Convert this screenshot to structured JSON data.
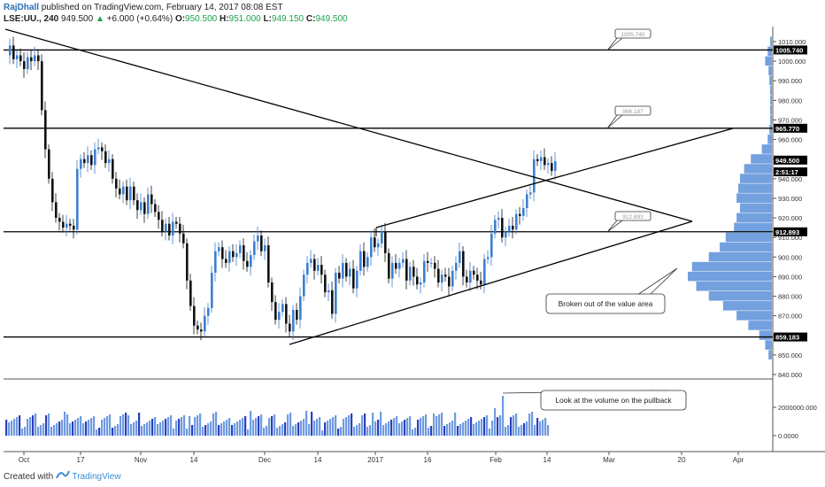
{
  "header": {
    "author": "RajDhall",
    "published": "published on TradingView.com, February 14, 2017 08:08 EST",
    "symbol": "LSE:UU., 240",
    "last": "949.500",
    "change_arrow": "▲",
    "change": "+6.000 (+0.64%)",
    "o_label": "O:",
    "o_value": "950.500",
    "h_label": "H:",
    "h_value": "951.000",
    "l_label": "L:",
    "l_value": "949.150",
    "c_label": "C:",
    "c_value": "949.500"
  },
  "footer": {
    "created_with": "Created with",
    "brand": "TradingView"
  },
  "colors": {
    "up_candle": "#3d7fd0",
    "down_candle": "#111111",
    "volume": "#6f9be0",
    "volume_profile": "#5b8fd8",
    "tag": "#000000"
  },
  "chart_data": {
    "type": "candlestick",
    "price_axis": {
      "min": 840,
      "max": 1015,
      "ticks": [
        "1010.000",
        "1000.000",
        "990.000",
        "980.000",
        "970.000",
        "960.000",
        "950.000",
        "940.000",
        "930.000",
        "920.000",
        "910.000",
        "900.000",
        "890.000",
        "880.000",
        "870.000",
        "860.000",
        "850.000",
        "840.000"
      ]
    },
    "volume_axis": {
      "ticks": [
        "2000000.000",
        "0.0000"
      ]
    },
    "x_ticks": [
      "Oct",
      "17",
      "Nov",
      "14",
      "Dec",
      "14",
      "2017",
      "16",
      "Feb",
      "14",
      "Mar",
      "20",
      "Apr"
    ],
    "price_tags": [
      {
        "label": "1005.740",
        "value": 1005.74,
        "style": "solid"
      },
      {
        "label": "965.770",
        "value": 965.77,
        "style": "solid"
      },
      {
        "label": "949.500",
        "value": 949.5,
        "style": "solid"
      },
      {
        "label": "2:51:17",
        "value": 943.5,
        "style": "solid"
      },
      {
        "label": "912.893",
        "value": 912.893,
        "style": "solid"
      },
      {
        "label": "859.183",
        "value": 859.183,
        "style": "solid"
      }
    ],
    "horizontal_levels": [
      1005.74,
      965.77,
      912.893,
      859.183
    ],
    "level_callouts": [
      "1005.740",
      "966.187",
      "912.893"
    ],
    "annotations": [
      "Broken out of the value area",
      "Look at the volume on the pullback"
    ],
    "price_path": [
      [
        0,
        1003
      ],
      [
        4,
        1008
      ],
      [
        8,
        1001
      ],
      [
        12,
        1003
      ],
      [
        16,
        1000
      ],
      [
        20,
        996
      ],
      [
        24,
        1002
      ],
      [
        28,
        1000
      ],
      [
        32,
        1003
      ],
      [
        36,
        1000
      ],
      [
        40,
        975
      ],
      [
        44,
        955
      ],
      [
        48,
        940
      ],
      [
        52,
        928
      ],
      [
        56,
        920
      ],
      [
        60,
        918
      ],
      [
        64,
        915
      ],
      [
        68,
        917
      ],
      [
        72,
        916
      ],
      [
        76,
        914
      ],
      [
        80,
        945
      ],
      [
        84,
        950
      ],
      [
        88,
        948
      ],
      [
        92,
        952
      ],
      [
        96,
        947
      ],
      [
        100,
        955
      ],
      [
        104,
        956
      ],
      [
        108,
        954
      ],
      [
        112,
        948
      ],
      [
        116,
        950
      ],
      [
        120,
        940
      ],
      [
        124,
        935
      ],
      [
        128,
        932
      ],
      [
        132,
        936
      ],
      [
        136,
        929
      ],
      [
        140,
        936
      ],
      [
        144,
        929
      ],
      [
        148,
        924
      ],
      [
        152,
        928
      ],
      [
        156,
        922
      ],
      [
        160,
        932
      ],
      [
        164,
        927
      ],
      [
        168,
        923
      ],
      [
        172,
        919
      ],
      [
        176,
        913
      ],
      [
        180,
        917
      ],
      [
        184,
        911
      ],
      [
        188,
        918
      ],
      [
        192,
        917
      ],
      [
        196,
        912
      ],
      [
        200,
        907
      ],
      [
        204,
        888
      ],
      [
        208,
        875
      ],
      [
        212,
        865
      ],
      [
        216,
        863
      ],
      [
        220,
        862
      ],
      [
        224,
        870
      ],
      [
        228,
        874
      ],
      [
        232,
        892
      ],
      [
        236,
        903
      ],
      [
        240,
        905
      ],
      [
        244,
        899
      ],
      [
        248,
        897
      ],
      [
        252,
        903
      ],
      [
        256,
        900
      ],
      [
        260,
        902
      ],
      [
        264,
        906
      ],
      [
        268,
        898
      ],
      [
        272,
        895
      ],
      [
        276,
        901
      ],
      [
        280,
        908
      ],
      [
        284,
        911
      ],
      [
        288,
        903
      ],
      [
        292,
        906
      ],
      [
        296,
        887
      ],
      [
        300,
        877
      ],
      [
        304,
        868
      ],
      [
        308,
        872
      ],
      [
        312,
        876
      ],
      [
        316,
        866
      ],
      [
        320,
        862
      ],
      [
        324,
        873
      ],
      [
        328,
        868
      ],
      [
        332,
        880
      ],
      [
        336,
        891
      ],
      [
        340,
        897
      ],
      [
        344,
        899
      ],
      [
        348,
        893
      ],
      [
        352,
        896
      ],
      [
        356,
        891
      ],
      [
        360,
        882
      ],
      [
        364,
        883
      ],
      [
        368,
        871
      ],
      [
        372,
        892
      ],
      [
        376,
        889
      ],
      [
        380,
        897
      ],
      [
        384,
        890
      ],
      [
        388,
        894
      ],
      [
        392,
        884
      ],
      [
        396,
        893
      ],
      [
        400,
        903
      ],
      [
        404,
        895
      ],
      [
        408,
        900
      ],
      [
        412,
        910
      ],
      [
        416,
        905
      ],
      [
        420,
        907
      ],
      [
        424,
        913
      ],
      [
        428,
        902
      ],
      [
        432,
        889
      ],
      [
        436,
        897
      ],
      [
        440,
        894
      ],
      [
        444,
        897
      ],
      [
        448,
        899
      ],
      [
        452,
        888
      ],
      [
        456,
        895
      ],
      [
        460,
        890
      ],
      [
        464,
        886
      ],
      [
        468,
        887
      ],
      [
        472,
        898
      ],
      [
        476,
        897
      ],
      [
        480,
        897
      ],
      [
        484,
        894
      ],
      [
        488,
        887
      ],
      [
        492,
        891
      ],
      [
        496,
        890
      ],
      [
        500,
        885
      ],
      [
        504,
        893
      ],
      [
        508,
        897
      ],
      [
        512,
        903
      ],
      [
        516,
        890
      ],
      [
        520,
        887
      ],
      [
        524,
        893
      ],
      [
        528,
        891
      ],
      [
        532,
        888
      ],
      [
        536,
        886
      ],
      [
        540,
        899
      ],
      [
        544,
        900
      ],
      [
        548,
        912
      ],
      [
        552,
        919
      ],
      [
        556,
        920
      ],
      [
        560,
        910
      ],
      [
        564,
        913
      ],
      [
        568,
        916
      ],
      [
        572,
        914
      ],
      [
        576,
        922
      ],
      [
        580,
        921
      ],
      [
        584,
        925
      ],
      [
        588,
        932
      ],
      [
        592,
        933
      ],
      [
        596,
        950
      ],
      [
        600,
        949
      ],
      [
        604,
        951
      ],
      [
        608,
        947
      ],
      [
        612,
        948
      ],
      [
        616,
        944
      ],
      [
        620,
        949
      ]
    ],
    "volume_profile": [
      {
        "price": 1010,
        "vol": 0.02
      },
      {
        "price": 1005,
        "vol": 0.05
      },
      {
        "price": 1000,
        "vol": 0.08
      },
      {
        "price": 995,
        "vol": 0.04
      },
      {
        "price": 990,
        "vol": 0.03
      },
      {
        "price": 985,
        "vol": 0.02
      },
      {
        "price": 980,
        "vol": 0.02
      },
      {
        "price": 975,
        "vol": 0.02
      },
      {
        "price": 970,
        "vol": 0.02
      },
      {
        "price": 965,
        "vol": 0.03
      },
      {
        "price": 960,
        "vol": 0.05
      },
      {
        "price": 955,
        "vol": 0.12
      },
      {
        "price": 950,
        "vol": 0.25
      },
      {
        "price": 945,
        "vol": 0.33
      },
      {
        "price": 940,
        "vol": 0.38
      },
      {
        "price": 935,
        "vol": 0.4
      },
      {
        "price": 930,
        "vol": 0.42
      },
      {
        "price": 925,
        "vol": 0.38
      },
      {
        "price": 920,
        "vol": 0.42
      },
      {
        "price": 915,
        "vol": 0.45
      },
      {
        "price": 910,
        "vol": 0.55
      },
      {
        "price": 905,
        "vol": 0.62
      },
      {
        "price": 900,
        "vol": 0.75
      },
      {
        "price": 895,
        "vol": 0.95
      },
      {
        "price": 890,
        "vol": 1.0
      },
      {
        "price": 885,
        "vol": 0.9
      },
      {
        "price": 880,
        "vol": 0.75
      },
      {
        "price": 875,
        "vol": 0.58
      },
      {
        "price": 870,
        "vol": 0.42
      },
      {
        "price": 865,
        "vol": 0.28
      },
      {
        "price": 860,
        "vol": 0.15
      },
      {
        "price": 855,
        "vol": 0.08
      },
      {
        "price": 850,
        "vol": 0.04
      }
    ]
  }
}
